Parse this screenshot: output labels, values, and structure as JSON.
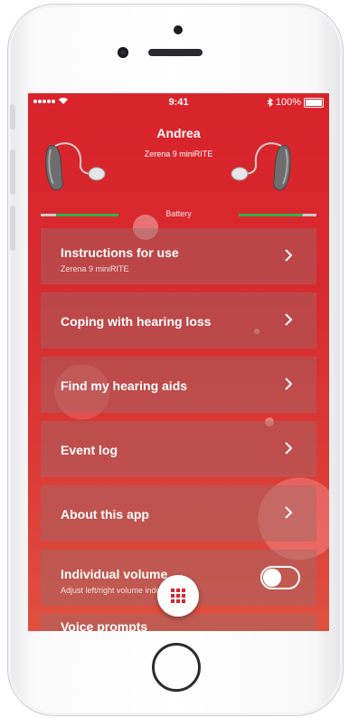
{
  "status_bar": {
    "time": "9:41",
    "battery_percent": "100%"
  },
  "header": {
    "user_name": "Andrea",
    "device_model": "Zerena 9 miniRITE",
    "battery_label": "Battery"
  },
  "battery": {
    "left_level": 0.8,
    "right_level": 0.82
  },
  "menu": {
    "items": [
      {
        "label": "Instructions for use",
        "sublabel": "Zerena 9 miniRITE"
      },
      {
        "label": "Coping with hearing loss"
      },
      {
        "label": "Find my hearing aids"
      },
      {
        "label": "Event log"
      },
      {
        "label": "About this app"
      },
      {
        "label": "Individual volume",
        "sublabel": "Adjust left/right volume independently",
        "toggle": "off"
      },
      {
        "label": "Voice prompts"
      }
    ]
  },
  "colors": {
    "accent": "#d9232b",
    "battery_ok": "#31b04a"
  },
  "icons": {
    "chevron": "chevron-right-icon",
    "fab": "grid-icon"
  }
}
